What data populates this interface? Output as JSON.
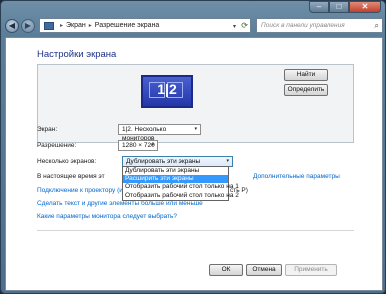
{
  "breadcrumb": [
    "Экран",
    "Разрешение экрана"
  ],
  "search": {
    "placeholder": "Поиск в панели управления"
  },
  "window_controls": {
    "minimize": "–",
    "maximize": "□",
    "close": "✕"
  },
  "nav": {
    "back": "◀",
    "forward": "▶",
    "addr_dropdown": "▾",
    "refresh": "⟳"
  },
  "page": {
    "title": "Настройки экрана",
    "monitor_label": "1|2",
    "find_button": "Найти",
    "identify_button": "Определить"
  },
  "settings": {
    "display_label": "Экран:",
    "display_value": "1|2. Несколько мониторов",
    "resolution_label": "Разрешение:",
    "resolution_value": "1280 × 720",
    "multi_label": "Несколько экранов:",
    "multi_value": "Дублировать эти экраны",
    "status_text_start": "В настоящее время эт",
    "status_text_end": "сть P)",
    "advanced_link": "Дополнительные параметры"
  },
  "dropdown_options": [
    {
      "label": "Дублировать эти экраны",
      "selected": false
    },
    {
      "label": "Расширить эти экраны",
      "selected": true
    },
    {
      "label": "Отобразить рабочий стол только на 1",
      "selected": false
    },
    {
      "label": "Отобразить рабочий стол только на 2",
      "selected": false
    }
  ],
  "links": {
    "projector": "Подключение к проектору (или нажмите клавишу",
    "text_size": "Сделать текст и другие элементы больше или меньше",
    "which_params": "Какие параметры монитора следует выбрать?"
  },
  "footer": {
    "ok": "ОК",
    "cancel": "Отмена",
    "apply": "Применить"
  },
  "icons": {
    "arrow": "▾",
    "search": "⌕"
  },
  "colors": {
    "title": "#1e3287",
    "link": "#0066cc",
    "selection": "#3399ff",
    "monitor": "#2337a8"
  }
}
